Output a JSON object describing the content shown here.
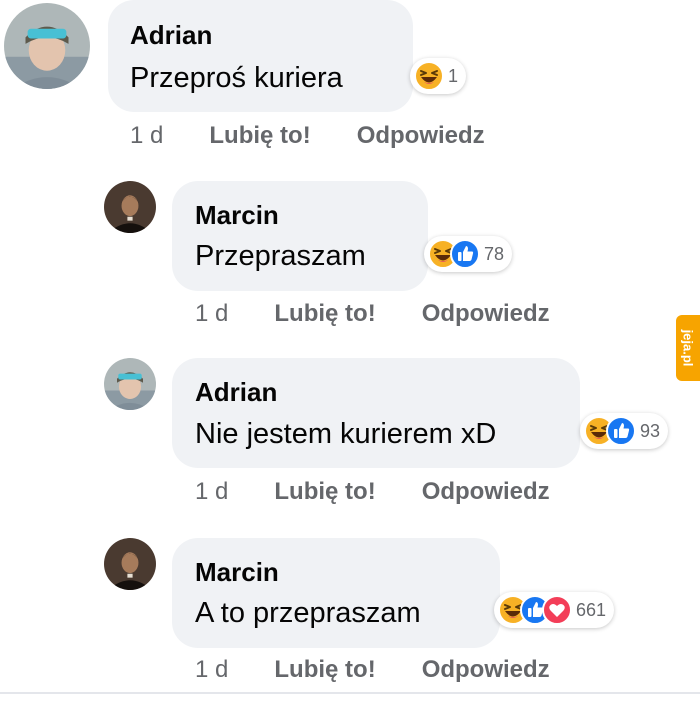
{
  "comments": [
    {
      "author": "Adrian",
      "text": "Przeproś kuriera",
      "reaction_count": "1",
      "reactions": [
        "haha"
      ],
      "time": "1 d",
      "like_label": "Lubię to!",
      "reply_label": "Odpowiedz"
    },
    {
      "author": "Marcin",
      "text": "Przepraszam",
      "reaction_count": "78",
      "reactions": [
        "haha",
        "like"
      ],
      "time": "1 d",
      "like_label": "Lubię to!",
      "reply_label": "Odpowiedz"
    },
    {
      "author": "Adrian",
      "text": "Nie jestem kurierem xD",
      "reaction_count": "93",
      "reactions": [
        "haha",
        "like"
      ],
      "time": "1 d",
      "like_label": "Lubię to!",
      "reply_label": "Odpowiedz"
    },
    {
      "author": "Marcin",
      "text": "A to przepraszam",
      "reaction_count": "661",
      "reactions": [
        "haha",
        "like",
        "love"
      ],
      "time": "1 d",
      "like_label": "Lubię to!",
      "reply_label": "Odpowiedz"
    }
  ],
  "watermark": "jeja.pl",
  "colors": {
    "bubble": "#f0f2f5",
    "meta_text": "#65676b",
    "like_blue": "#1877f2",
    "love_red": "#f33e58",
    "haha_yellow": "#f7b125",
    "watermark": "#f7a400"
  }
}
